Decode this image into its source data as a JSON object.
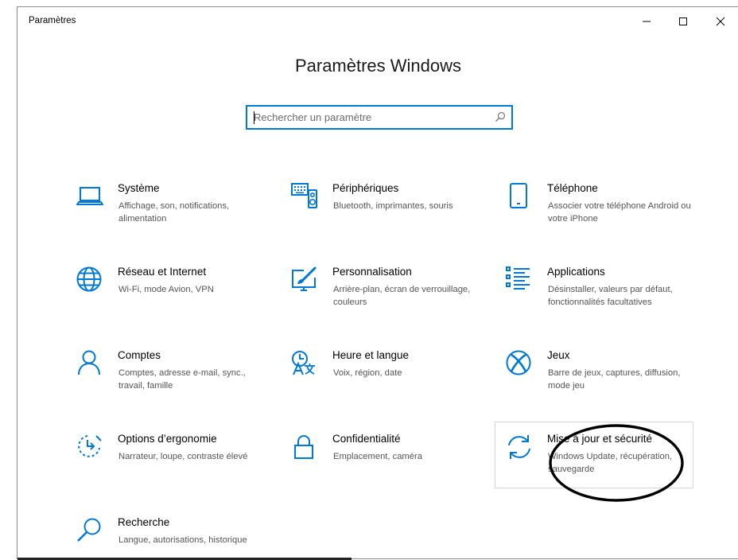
{
  "window": {
    "title": "Paramètres"
  },
  "header": {
    "title": "Paramètres Windows"
  },
  "search": {
    "placeholder": "Rechercher un paramètre"
  },
  "tiles": [
    {
      "title": "Système",
      "subtitle": "Affichage, son, notifications, alimentation",
      "icon": "laptop-icon"
    },
    {
      "title": "Périphériques",
      "subtitle": "Bluetooth, imprimantes, souris",
      "icon": "devices-icon"
    },
    {
      "title": "Téléphone",
      "subtitle": "Associer votre téléphone Android ou votre iPhone",
      "icon": "phone-icon"
    },
    {
      "title": "Réseau et Internet",
      "subtitle": "Wi-Fi, mode Avion, VPN",
      "icon": "globe-icon"
    },
    {
      "title": "Personnalisation",
      "subtitle": "Arrière-plan, écran de verrouillage, couleurs",
      "icon": "paintbrush-icon"
    },
    {
      "title": "Applications",
      "subtitle": "Désinstaller, valeurs par défaut, fonctionnalités facultatives",
      "icon": "apps-list-icon"
    },
    {
      "title": "Comptes",
      "subtitle": "Comptes, adresse e-mail, sync., travail, famille",
      "icon": "person-icon"
    },
    {
      "title": "Heure et langue",
      "subtitle": "Voix, région, date",
      "icon": "time-language-icon"
    },
    {
      "title": "Jeux",
      "subtitle": "Barre de jeux, captures, diffusion, mode jeu",
      "icon": "xbox-icon"
    },
    {
      "title": "Options d’ergonomie",
      "subtitle": "Narrateur, loupe, contraste élevé",
      "icon": "ease-of-access-icon"
    },
    {
      "title": "Confidentialité",
      "subtitle": "Emplacement, caméra",
      "icon": "lock-icon"
    },
    {
      "title": "Mise à jour et sécurité",
      "subtitle": "Windows Update, récupération, sauvegarde",
      "icon": "update-sync-icon"
    },
    {
      "title": "Recherche",
      "subtitle": "Langue, autorisations, historique",
      "icon": "search-magnifier-icon"
    }
  ],
  "colors": {
    "accent": "#0078d7",
    "annotation": "#000000"
  }
}
